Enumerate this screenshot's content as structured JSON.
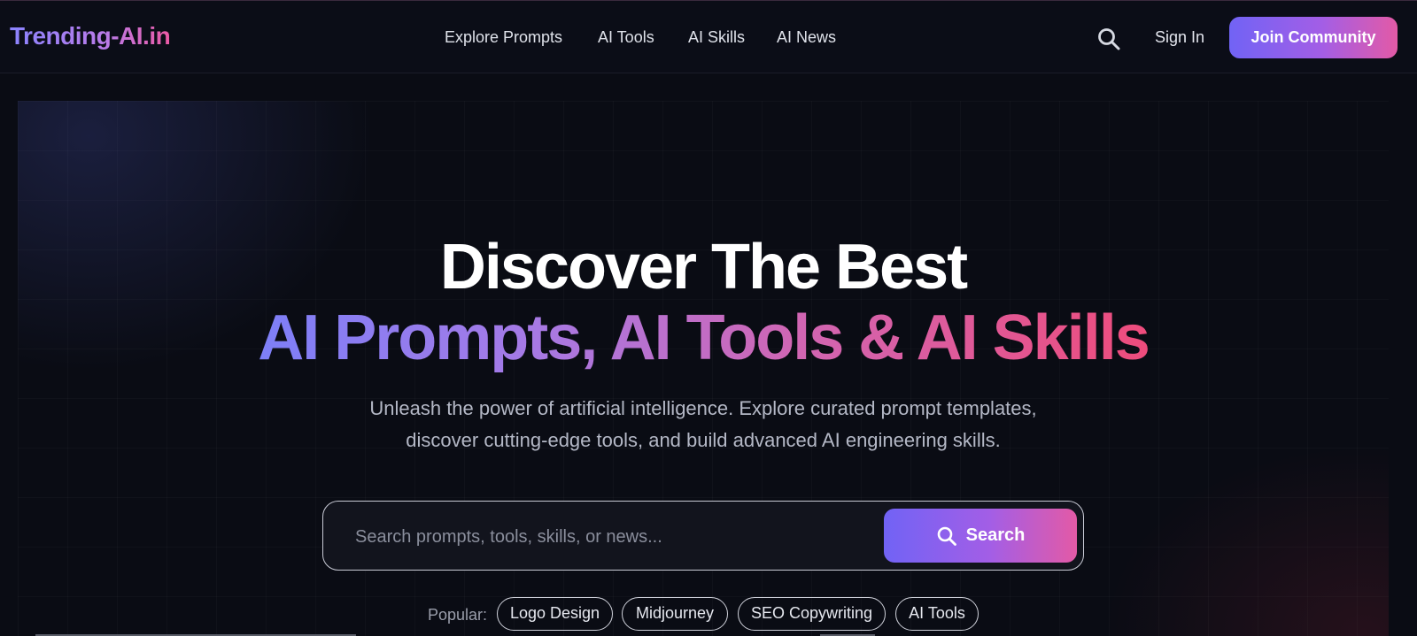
{
  "header": {
    "logo": "Trending-AI.in",
    "nav": [
      "Explore Prompts",
      "AI Tools",
      "AI Skills",
      "AI News"
    ],
    "search_icon": "search-icon",
    "sign_in": "Sign In",
    "join": "Join Community"
  },
  "hero": {
    "title": "Discover The Best",
    "subtitle": "AI Prompts, AI Tools & AI Skills",
    "description_line1": "Unleash the power of artificial intelligence. Explore curated prompt templates,",
    "description_line2": "discover cutting-edge tools, and build advanced AI engineering skills.",
    "search": {
      "placeholder": "Search prompts, tools, skills, or news...",
      "value": "",
      "button": "Search",
      "button_icon": "search-icon"
    },
    "popular_label": "Popular:",
    "popular_tags": [
      "Logo Design",
      "Midjourney",
      "SEO Copywriting",
      "AI Tools"
    ]
  },
  "colors": {
    "background": "#0a0c14",
    "accent_start": "#7163f5",
    "accent_end": "#e35aa6",
    "gradient_text_end": "#ee4c7c"
  }
}
